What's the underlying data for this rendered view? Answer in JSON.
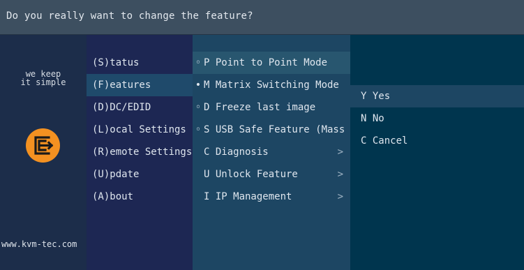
{
  "title": "Do you really want to change the feature?",
  "brand": {
    "tagline_line1": "we keep",
    "tagline_line2": "it simple",
    "url": "www.kvm-tec.com",
    "logo_color": "#f39121"
  },
  "menu": [
    {
      "label": "(S)tatus",
      "selected": false
    },
    {
      "label": "(F)eatures",
      "selected": true
    },
    {
      "label": "(D)DC/EDID",
      "selected": false
    },
    {
      "label": "(L)ocal  Settings",
      "selected": false
    },
    {
      "label": "(R)emote Settings",
      "selected": false
    },
    {
      "label": "(U)pdate",
      "selected": false
    },
    {
      "label": "(A)bout",
      "selected": false
    }
  ],
  "submenu": [
    {
      "bullet": "◦",
      "label": "P Point to Point Mode",
      "arrow": "",
      "selected": true
    },
    {
      "bullet": "•",
      "label": "M Matrix Switching Mode",
      "arrow": "",
      "selected": false
    },
    {
      "bullet": "◦",
      "label": "D Freeze last image",
      "arrow": "",
      "selected": false
    },
    {
      "bullet": "◦",
      "label": "S USB Safe Feature (Mass S",
      "arrow": "",
      "selected": false
    },
    {
      "bullet": "",
      "label": "C Diagnosis",
      "arrow": ">",
      "selected": false
    },
    {
      "bullet": "",
      "label": "U Unlock Feature",
      "arrow": ">",
      "selected": false
    },
    {
      "bullet": "",
      "label": "I IP Management",
      "arrow": ">",
      "selected": false
    }
  ],
  "confirm": [
    {
      "label": "Y Yes",
      "selected": true
    },
    {
      "label": "N No",
      "selected": false
    },
    {
      "label": "C Cancel",
      "selected": false
    }
  ]
}
